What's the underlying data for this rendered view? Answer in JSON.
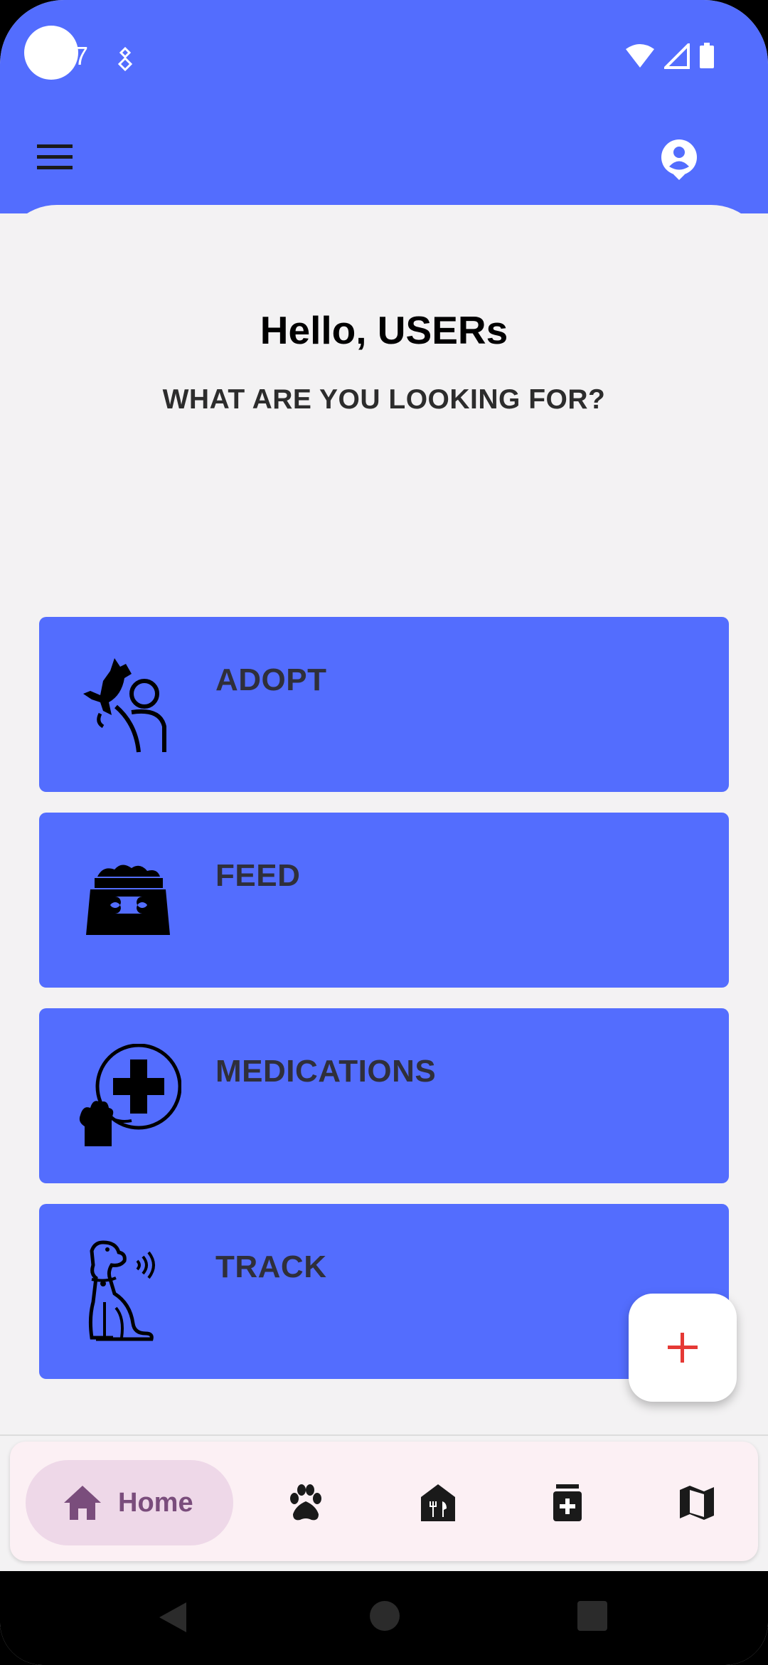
{
  "status_bar": {
    "time": "7",
    "icons": [
      "notification-icon",
      "wifi-icon",
      "signal-icon",
      "battery-icon"
    ]
  },
  "app_bar": {
    "menu_icon": "menu-icon",
    "profile_icon": "account-icon"
  },
  "header": {
    "greeting": "Hello, USERs",
    "subtitle": "WHAT ARE YOU LOOKING FOR?"
  },
  "cards": [
    {
      "label": "ADOPT",
      "icon": "adopt-pet-icon"
    },
    {
      "label": "FEED",
      "icon": "food-bowl-icon"
    },
    {
      "label": "MEDICATIONS",
      "icon": "medical-cross-icon"
    },
    {
      "label": "TRACK",
      "icon": "tracked-dog-icon"
    }
  ],
  "fab": {
    "icon": "plus-icon"
  },
  "bottom_nav": {
    "items": [
      {
        "label": "Home",
        "icon": "home-icon",
        "selected": true
      },
      {
        "label": "",
        "icon": "paw-icon"
      },
      {
        "label": "",
        "icon": "restaurant-icon"
      },
      {
        "label": "",
        "icon": "medicine-icon"
      },
      {
        "label": "",
        "icon": "map-icon"
      }
    ]
  },
  "colors": {
    "primary": "#536dfe",
    "background": "#f3f2f3",
    "accent_plus": "#e53935",
    "nav_selected": "#7a4d7c"
  }
}
